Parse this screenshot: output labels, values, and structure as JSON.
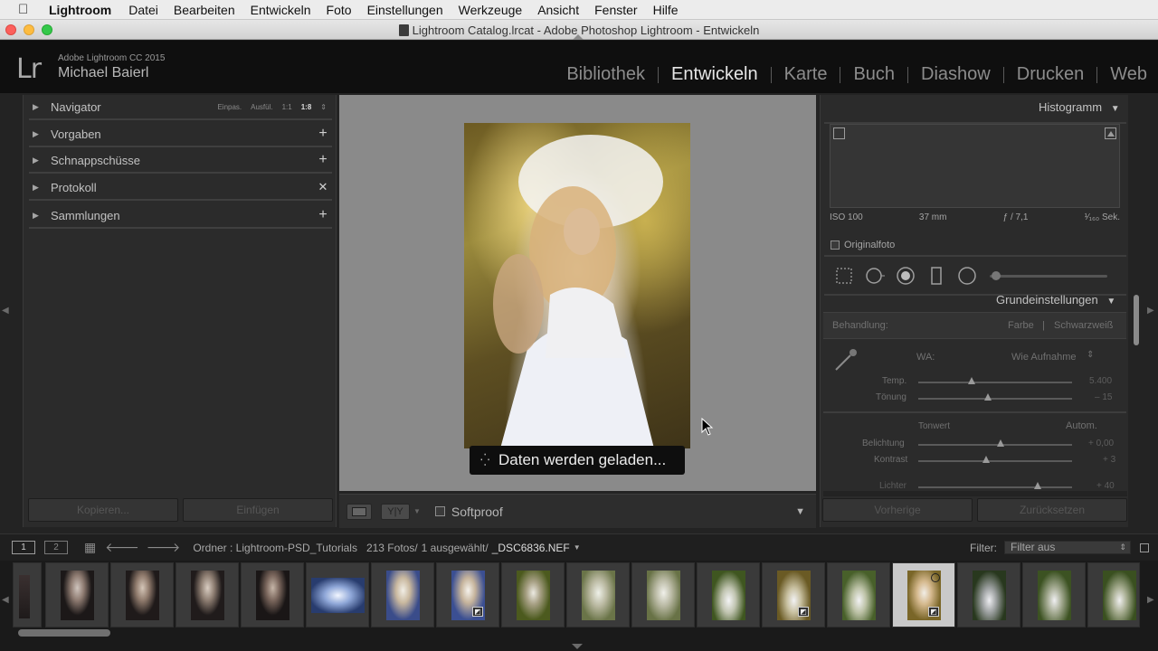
{
  "menubar": {
    "app": "Lightroom",
    "items": [
      "Datei",
      "Bearbeiten",
      "Entwickeln",
      "Foto",
      "Einstellungen",
      "Werkzeuge",
      "Ansicht",
      "Fenster",
      "Hilfe"
    ]
  },
  "window": {
    "title": "Lightroom Catalog.lrcat - Adobe Photoshop Lightroom - Entwickeln"
  },
  "identity": {
    "logo": "Lr",
    "product": "Adobe Lightroom CC 2015",
    "user": "Michael Baierl"
  },
  "modules": [
    "Bibliothek",
    "Entwickeln",
    "Karte",
    "Buch",
    "Diashow",
    "Drucken",
    "Web"
  ],
  "left_panel": {
    "navigator": {
      "label": "Navigator",
      "options": [
        "Einpas.",
        "Ausfül.",
        "1:1",
        "1:8"
      ]
    },
    "rows": [
      {
        "label": "Vorgaben",
        "action": "+"
      },
      {
        "label": "Schnappschüsse",
        "action": "+"
      },
      {
        "label": "Protokoll",
        "action": "✕"
      },
      {
        "label": "Sammlungen",
        "action": "+"
      }
    ],
    "copy_button": "Kopieren...",
    "paste_button": "Einfügen"
  },
  "loading": {
    "text": "Daten werden geladen..."
  },
  "toolbar": {
    "softproof": "Softproof",
    "compare": "Y|Y"
  },
  "right_panel": {
    "histogram_title": "Histogramm",
    "exif": {
      "iso": "ISO 100",
      "focal": "37 mm",
      "aperture": "ƒ / 7,1",
      "shutter": "¹⁄₁₆₀ Sek."
    },
    "original": "Originalfoto",
    "basic_title": "Grundeinstellungen",
    "treatment_label": "Behandlung:",
    "treatment_color": "Farbe",
    "treatment_bw": "Schwarzweiß",
    "wb_label": "WA:",
    "wb_value": "Wie Aufnahme",
    "temp_label": "Temp.",
    "temp_value": "5.400",
    "tint_label": "Tönung",
    "tint_value": "– 15",
    "tone_label": "Tonwert",
    "auto_label": "Autom.",
    "exposure_label": "Belichtung",
    "exposure_value": "+ 0,00",
    "contrast_label": "Kontrast",
    "contrast_value": "+ 3",
    "highlights_label": "Lichter",
    "highlights_value": "+ 40",
    "prev_button": "Vorherige",
    "reset_button": "Zurücksetzen"
  },
  "filmbar": {
    "screen1": "1",
    "screen2": "2",
    "path": "Ordner : Lightroom-PSD_Tutorials",
    "count": "213 Fotos/",
    "selected": "1 ausgewählt/",
    "filename": "_DSC6836.NEF",
    "filter_label": "Filter:",
    "filter_value": "Filter aus"
  },
  "colors": {
    "accent_active": "#e6e6e6",
    "panel_bg": "#2b2b2b",
    "canvas_bg": "#8a8a8a"
  }
}
